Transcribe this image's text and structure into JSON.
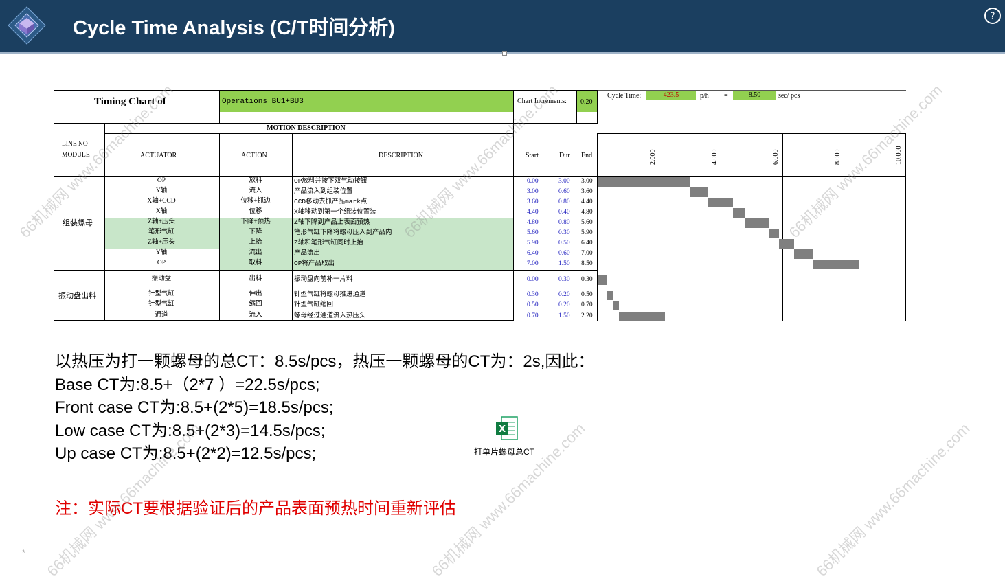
{
  "header": {
    "title": "Cycle Time Analysis (C/T时间分析)"
  },
  "chart": {
    "timing_chart_label": "Timing Chart of",
    "operations": "Operations BU1+BU3",
    "chart_increments_label": "Chart Increments:",
    "chart_increments_value": "0.20",
    "cycle_time_label": "Cycle Time:",
    "cycle_time_value": "423.5",
    "per_hour_unit": "p/h",
    "equals": "=",
    "sec_per_pcs_value": "8.50",
    "sec_per_pcs_unit": "sec/ pcs",
    "motion_description": "MOTION DESCRIPTION",
    "col_line_no": "LINE NO",
    "col_module": "MODULE",
    "col_actuator": "ACTUATOR",
    "col_action": "ACTION",
    "col_description": "DESCRIPTION",
    "col_start": "Start",
    "col_dur": "Dur",
    "col_end": "End",
    "ticks": [
      "2.000",
      "4.000",
      "6.000",
      "8.000",
      "10.000"
    ],
    "modules": [
      {
        "name": "组装螺母",
        "rows": [
          {
            "actuator": "OP",
            "action": "放料",
            "description": "OP放料并按下双气动按钮",
            "start": "0.00",
            "dur": "3.00",
            "end": "3.00",
            "highlight": false
          },
          {
            "actuator": "Y轴",
            "action": "流入",
            "description": "产品流入到组装位置",
            "start": "3.00",
            "dur": "0.60",
            "end": "3.60",
            "highlight": false
          },
          {
            "actuator": "X轴+CCD",
            "action": "位移+抓边",
            "description": "CCD移动去抓产品mark点",
            "start": "3.60",
            "dur": "0.80",
            "end": "4.40",
            "highlight": false
          },
          {
            "actuator": "X轴",
            "action": "位移",
            "description": "X轴移动到第一个组装位置装",
            "start": "4.40",
            "dur": "0.40",
            "end": "4.80",
            "highlight": false
          },
          {
            "actuator": "Z轴+压头",
            "action": "下降+预热",
            "description": "Z轴下降到产品上表面预热",
            "start": "4.80",
            "dur": "0.80",
            "end": "5.60",
            "highlight": true
          },
          {
            "actuator": "笔形气缸",
            "action": "下降",
            "description": "笔形气缸下降将螺母压入到产品内",
            "start": "5.60",
            "dur": "0.30",
            "end": "5.90",
            "highlight": true
          },
          {
            "actuator": "Z轴+压头",
            "action": "上抬",
            "description": "Z轴和笔形气缸同时上抬",
            "start": "5.90",
            "dur": "0.50",
            "end": "6.40",
            "highlight": true
          },
          {
            "actuator": "Y轴",
            "action": "流出",
            "description": "产品流出",
            "start": "6.40",
            "dur": "0.60",
            "end": "7.00",
            "highlight": true
          },
          {
            "actuator": "OP",
            "action": "取料",
            "description": "OP将产品取出",
            "start": "7.00",
            "dur": "1.50",
            "end": "8.50",
            "highlight": true
          }
        ]
      },
      {
        "name": "振动盘出料",
        "rows": [
          {
            "actuator": "振动盘",
            "action": "出料",
            "description": "振动盘向前补一片料",
            "start": "0.00",
            "dur": "0.30",
            "end": "0.30",
            "highlight": false
          },
          {
            "actuator": "针型气缸",
            "action": "伸出",
            "description": "针型气缸将螺母推进通道",
            "start": "0.30",
            "dur": "0.20",
            "end": "0.50",
            "highlight": false
          },
          {
            "actuator": "针型气缸",
            "action": "缩回",
            "description": "针型气缸缩回",
            "start": "0.50",
            "dur": "0.20",
            "end": "0.70",
            "highlight": false
          },
          {
            "actuator": "通道",
            "action": "流入",
            "description": "螺母经过通道流入热压头",
            "start": "0.70",
            "dur": "1.50",
            "end": "2.20",
            "highlight": false
          }
        ]
      }
    ]
  },
  "notes": [
    "以热压为打一颗螺母的总CT：8.5s/pcs，热压一颗螺母的CT为：2s,因此：",
    "Base CT为:8.5+（2*7 ）=22.5s/pcs;",
    "Front case CT为:8.5+(2*5)=18.5s/pcs;",
    "Low case CT为:8.5+(2*3)=14.5s/pcs;",
    "Up case CT为:8.5+(2*2)=12.5s/pcs;"
  ],
  "warning": "注：实际CT要根据验证后的产品表面预热时间重新评估",
  "attachment": {
    "label": "打单片螺母总CT",
    "icon": "excel-file-icon"
  },
  "watermark": "66机械网 www.66machine.com",
  "colors": {
    "header_bg": "#1b3f60",
    "green": "#92d050",
    "light_green": "#c8e6c9",
    "bar": "#7f7f7f",
    "warning": "#e00000",
    "value_blue": "#2020c0"
  }
}
